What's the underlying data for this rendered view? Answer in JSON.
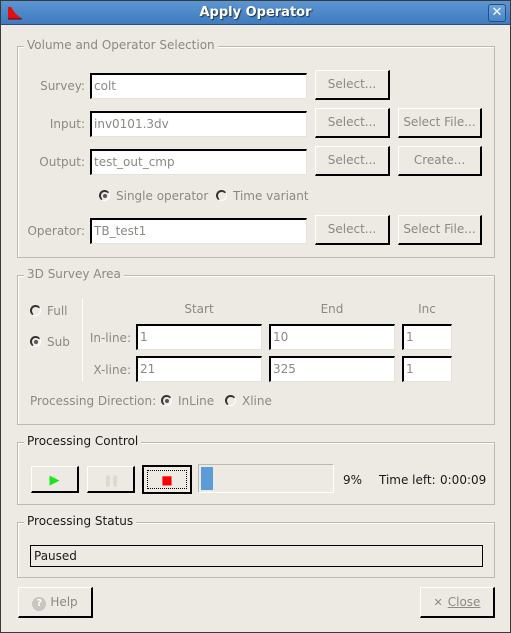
{
  "window": {
    "title": "Apply Operator",
    "close_glyph": "✕"
  },
  "volume_selection": {
    "label": "Volume and Operator Selection",
    "survey": {
      "label": "Survey:",
      "value": "colt",
      "select_label": "Select..."
    },
    "input": {
      "label": "Input:",
      "value": "inv0101.3dv",
      "select_label": "Select...",
      "select_file_label": "Select File..."
    },
    "output": {
      "label": "Output:",
      "value": "test_out_cmp",
      "select_label": "Select...",
      "create_label": "Create..."
    },
    "operator_mode": {
      "options": [
        {
          "label": "Single operator",
          "selected": true
        },
        {
          "label": "Time variant",
          "selected": false
        }
      ]
    },
    "operator": {
      "label": "Operator:",
      "value": "TB_test1",
      "select_label": "Select...",
      "select_file_label": "Select File..."
    }
  },
  "survey_area": {
    "label": "3D Survey Area",
    "mode_options": [
      {
        "label": "Full",
        "selected": false
      },
      {
        "label": "Sub",
        "selected": true
      }
    ],
    "columns": [
      "Start",
      "End",
      "Inc"
    ],
    "rows": [
      {
        "label": "In-line:",
        "start": "1",
        "end": "10",
        "inc": "1"
      },
      {
        "label": "X-line:",
        "start": "21",
        "end": "325",
        "inc": "1"
      }
    ],
    "direction": {
      "label": "Processing Direction:",
      "options": [
        {
          "label": "InLine",
          "selected": true
        },
        {
          "label": "Xline",
          "selected": false
        }
      ]
    }
  },
  "processing_control": {
    "label": "Processing Control",
    "play_icon": "▶",
    "pause_icon": "❚❚",
    "stop_icon": "■",
    "progress_percent": 9,
    "progress_text": "9%",
    "time_left_label": "Time left:",
    "time_left_value": "0:00:09",
    "colors": {
      "play": "#19e619",
      "stop": "#ff0000",
      "progress": "#5b9bd8"
    }
  },
  "processing_status": {
    "label": "Processing Status",
    "value": "Paused"
  },
  "footer": {
    "help_label": "Help",
    "help_icon": "?",
    "close_label": "Close",
    "close_icon": "✕"
  }
}
